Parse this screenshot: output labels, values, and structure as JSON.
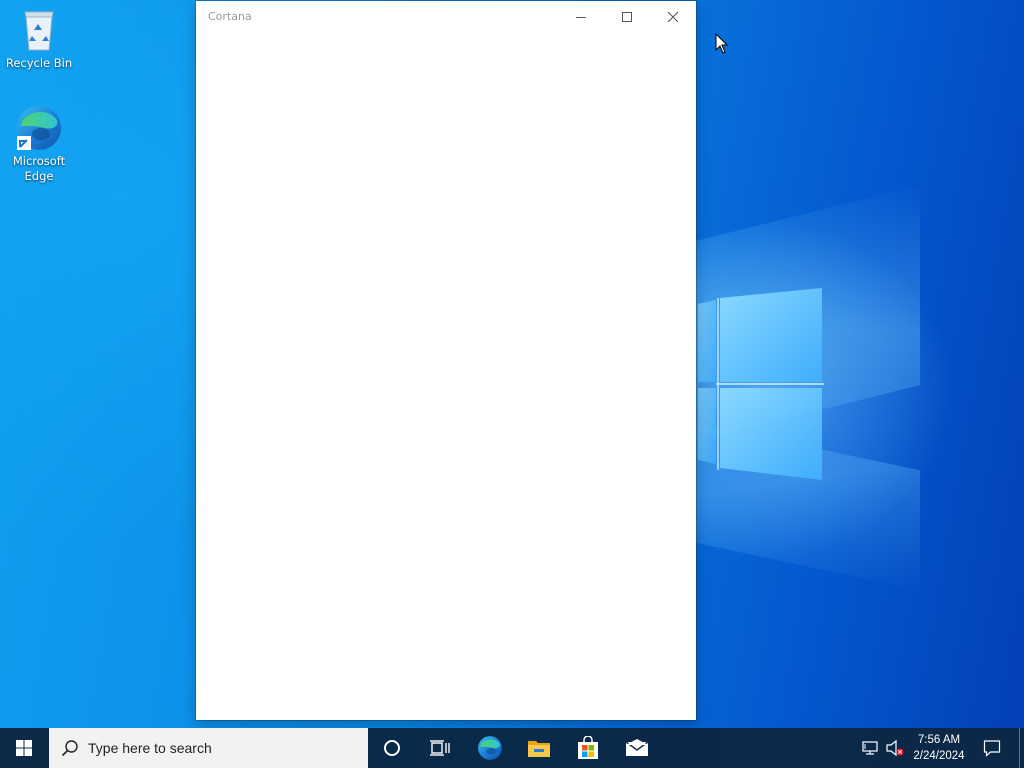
{
  "desktop": {
    "icons": [
      {
        "label_line1": "Recycle Bin",
        "label_line2": "",
        "icon": "recycle-bin-icon"
      },
      {
        "label_line1": "Microsoft",
        "label_line2": "Edge",
        "icon": "edge-icon"
      }
    ]
  },
  "window": {
    "title": "Cortana",
    "controls": {
      "minimize": "minimize-icon",
      "maximize": "maximize-icon",
      "close": "close-icon"
    }
  },
  "taskbar": {
    "start_icon": "windows-start-icon",
    "search_placeholder": "Type here to search",
    "pinned": [
      {
        "name": "Cortana",
        "icon": "cortana-circle-icon"
      },
      {
        "name": "Task View",
        "icon": "task-view-icon"
      },
      {
        "name": "Microsoft Edge",
        "icon": "edge-icon"
      },
      {
        "name": "File Explorer",
        "icon": "folder-icon"
      },
      {
        "name": "Microsoft Store",
        "icon": "store-bag-icon"
      },
      {
        "name": "Mail",
        "icon": "mail-icon"
      }
    ],
    "tray": {
      "network_icon": "network-disconnected-icon",
      "volume_icon": "volume-muted-icon",
      "time": "7:56 AM",
      "date": "2/24/2024",
      "notification_icon": "action-center-icon"
    }
  },
  "colors": {
    "desktop_blue": "#0b86e4",
    "taskbar": "#0d2b48",
    "search_bg": "#f2f2f2",
    "window_bg": "#ffffff",
    "store_red": "#f25022",
    "store_green": "#7fba00",
    "store_blue": "#00a4ef",
    "store_yellow": "#ffb900",
    "folder_yellow": "#f7c948"
  }
}
